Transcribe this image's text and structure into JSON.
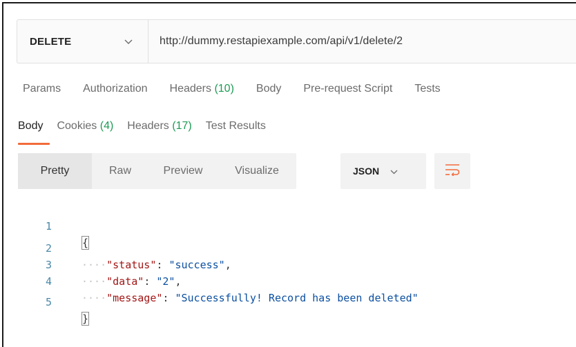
{
  "request": {
    "method": "DELETE",
    "url": "http://dummy.restapiexample.com/api/v1/delete/2"
  },
  "request_tabs": [
    {
      "label": "Params",
      "count": ""
    },
    {
      "label": "Authorization",
      "count": ""
    },
    {
      "label": "Headers",
      "count": "(10)"
    },
    {
      "label": "Body",
      "count": ""
    },
    {
      "label": "Pre-request Script",
      "count": ""
    },
    {
      "label": "Tests",
      "count": ""
    }
  ],
  "response_tabs": [
    {
      "label": "Body",
      "count": "",
      "active": true
    },
    {
      "label": "Cookies",
      "count": "(4)"
    },
    {
      "label": "Headers",
      "count": "(17)"
    },
    {
      "label": "Test Results",
      "count": ""
    }
  ],
  "view_modes": [
    "Pretty",
    "Raw",
    "Preview",
    "Visualize"
  ],
  "active_view_mode": "Pretty",
  "format": "JSON",
  "icons": {
    "method_dropdown": "chevron-down-icon",
    "format_dropdown": "chevron-down-icon",
    "wrap": "wrap-lines-icon"
  },
  "colors": {
    "accent": "#f26b3a",
    "count_green": "#1d9b55",
    "json_key": "#a31515",
    "json_string": "#0b4fa0",
    "line_number": "#4a87a8"
  },
  "code": {
    "line_numbers": [
      "1",
      "2",
      "3",
      "4",
      "5"
    ],
    "open_brace": "{",
    "close_brace": "}",
    "entries": [
      {
        "key": "\"status\"",
        "value": "\"success\"",
        "trailing": ","
      },
      {
        "key": "\"data\"",
        "value": "\"2\"",
        "trailing": ","
      },
      {
        "key": "\"message\"",
        "value": "\"Successfully! Record has been deleted\"",
        "trailing": ""
      }
    ]
  }
}
